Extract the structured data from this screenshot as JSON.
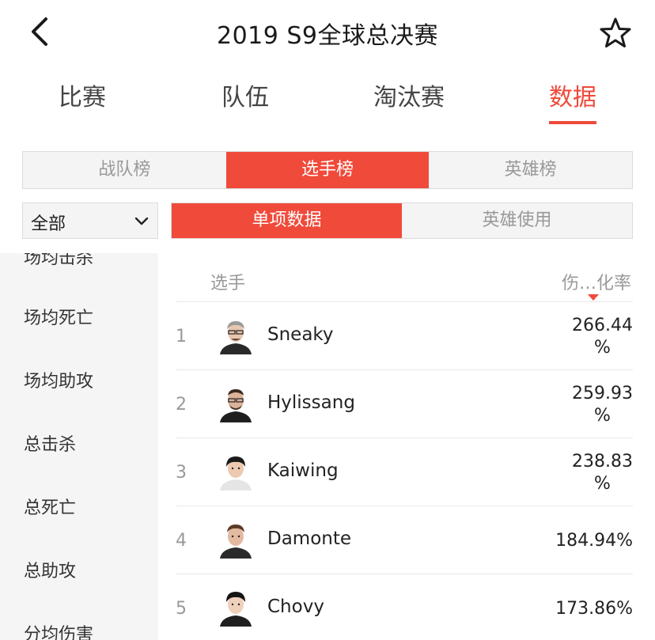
{
  "header": {
    "title": "2019 S9全球总决赛",
    "back_icon": "chevron-left-icon",
    "favorite_icon": "star-outline-icon"
  },
  "main_tabs": [
    {
      "label": "比赛",
      "active": false
    },
    {
      "label": "队伍",
      "active": false
    },
    {
      "label": "淘汰赛",
      "active": false
    },
    {
      "label": "数据",
      "active": true
    }
  ],
  "sub_tabs": [
    {
      "label": "战队榜",
      "active": false
    },
    {
      "label": "选手榜",
      "active": true
    },
    {
      "label": "英雄榜",
      "active": false
    }
  ],
  "filter": {
    "selected": "全部",
    "icon": "chevron-down-icon"
  },
  "data_tabs": [
    {
      "label": "单项数据",
      "active": true
    },
    {
      "label": "英雄使用",
      "active": false
    }
  ],
  "sidebar": {
    "items": [
      {
        "label": "场均击杀"
      },
      {
        "label": "场均死亡"
      },
      {
        "label": "场均助攻"
      },
      {
        "label": "总击杀"
      },
      {
        "label": "总死亡"
      },
      {
        "label": "总助攻"
      },
      {
        "label": "分均伤害"
      }
    ]
  },
  "table": {
    "columns": {
      "player": "选手",
      "stat": "伤…化率"
    },
    "sort": "descending",
    "accent_color": "#f04a3a",
    "rows": [
      {
        "rank": "1",
        "name": "Sneaky",
        "value_line1": "266.44",
        "value_line2": "%"
      },
      {
        "rank": "2",
        "name": "Hylissang",
        "value_line1": "259.93",
        "value_line2": "%"
      },
      {
        "rank": "3",
        "name": "Kaiwing",
        "value_line1": "238.83",
        "value_line2": "%"
      },
      {
        "rank": "4",
        "name": "Damonte",
        "value_line1": "184.94%",
        "value_line2": ""
      },
      {
        "rank": "5",
        "name": "Chovy",
        "value_line1": "173.86%",
        "value_line2": ""
      }
    ]
  }
}
